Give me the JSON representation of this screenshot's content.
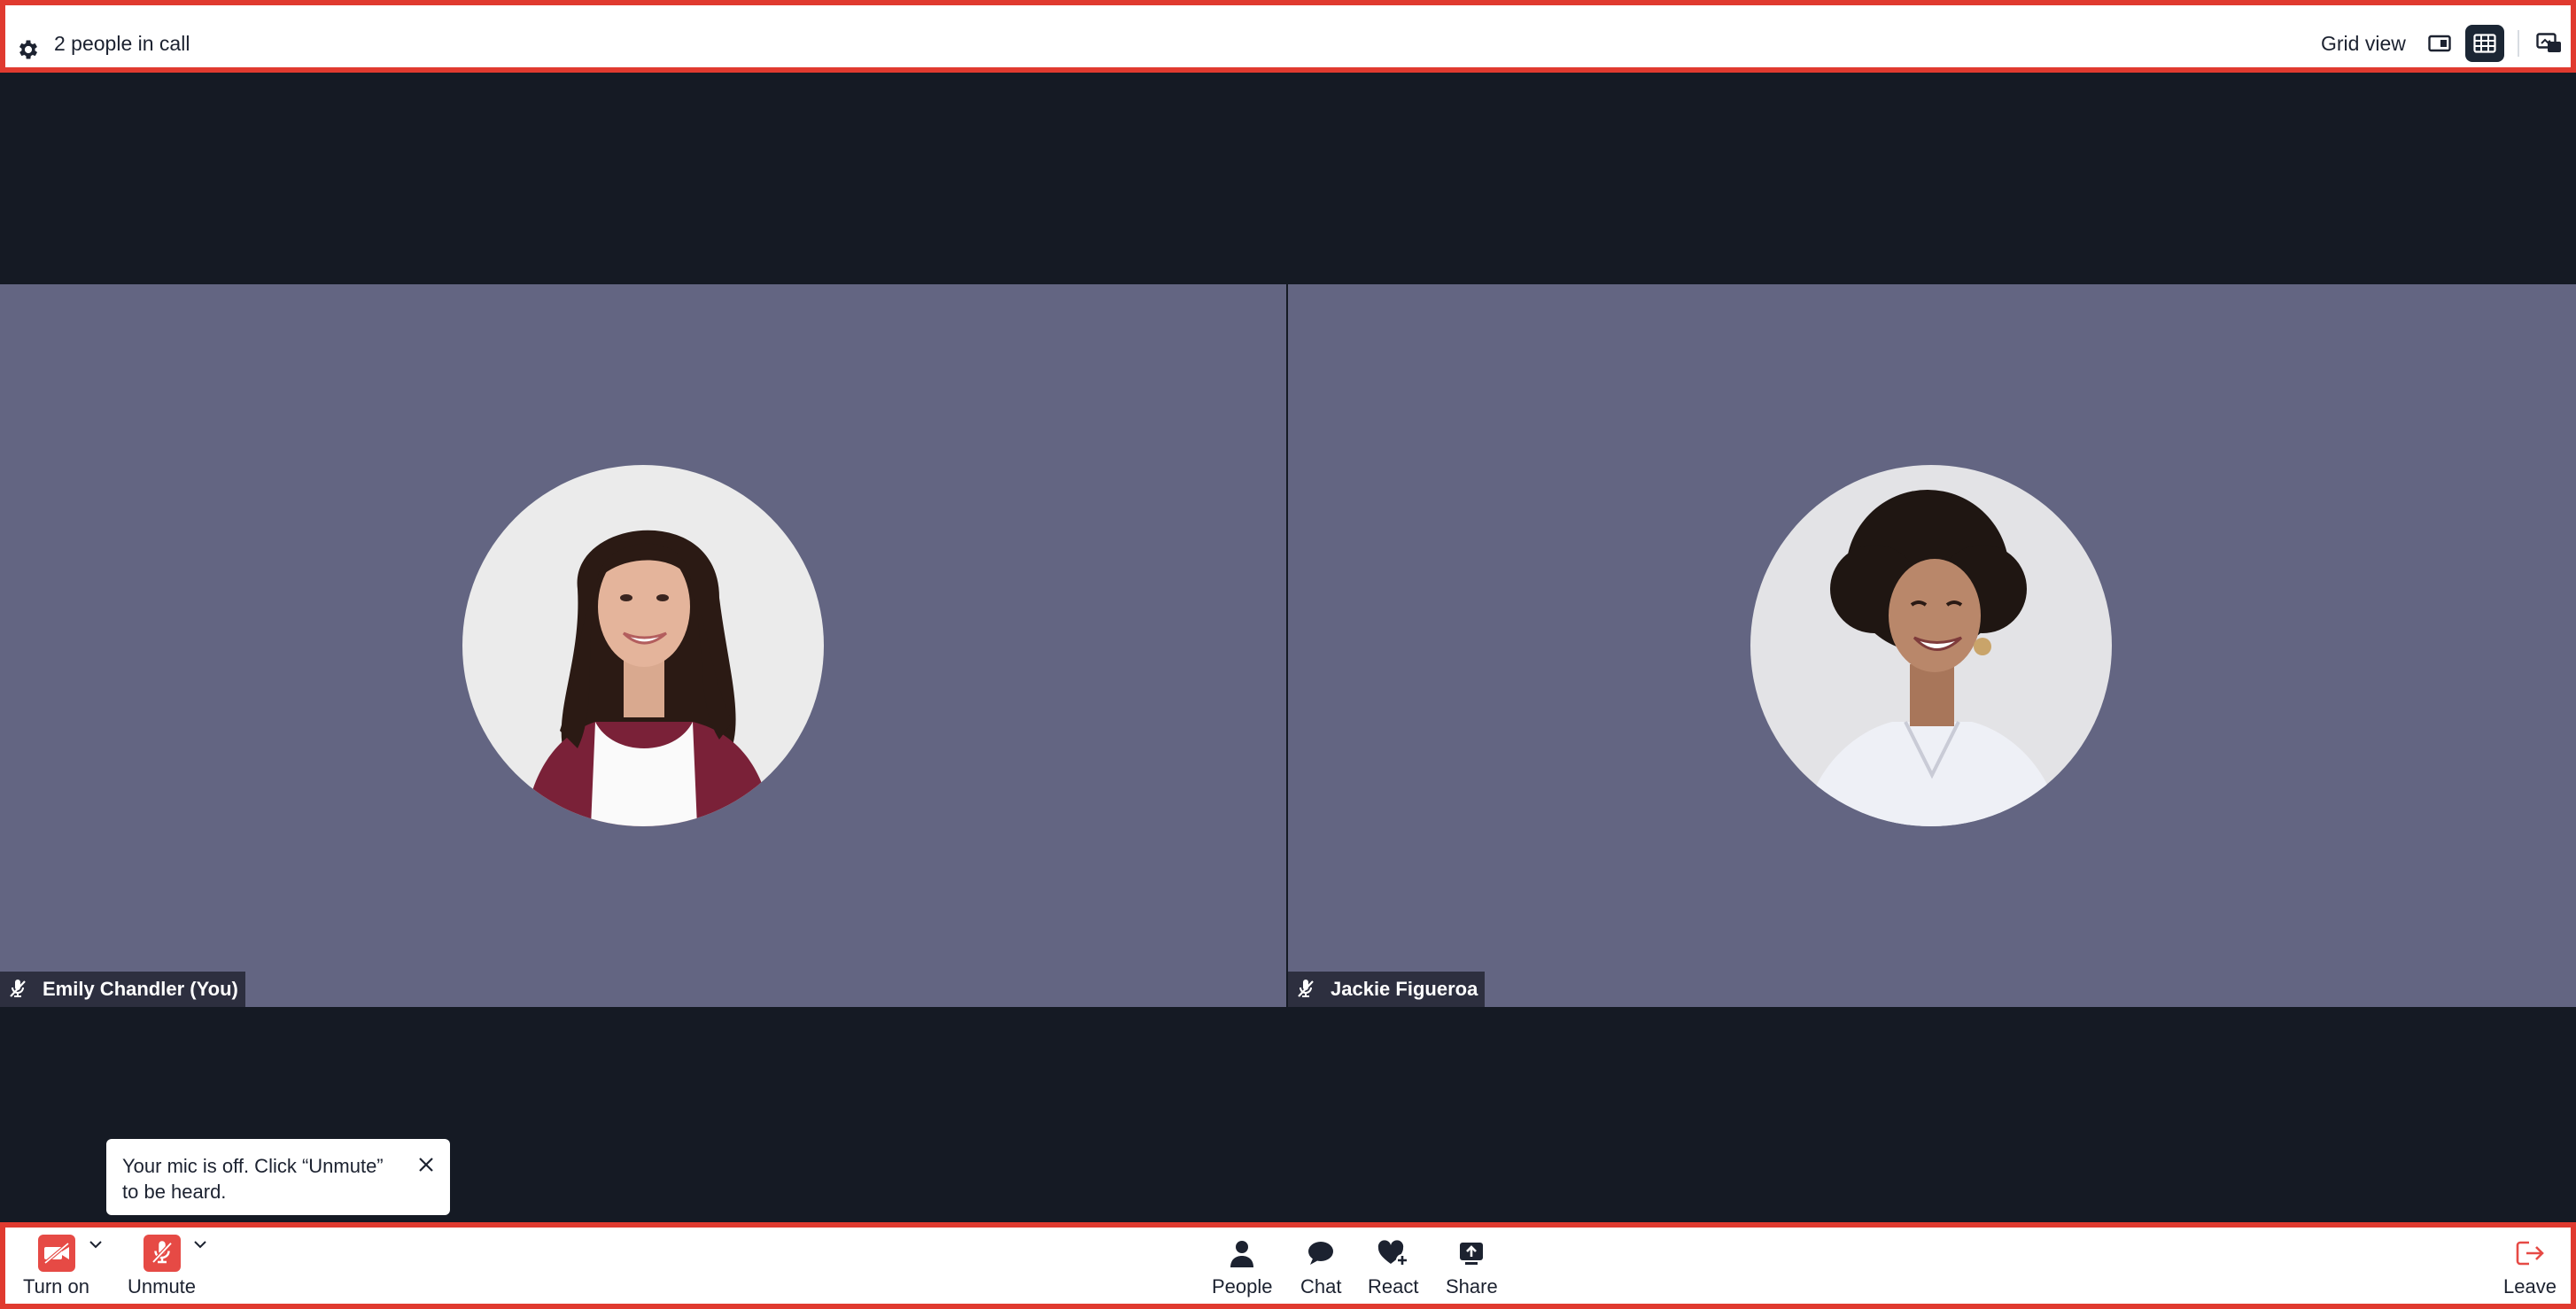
{
  "header": {
    "people_count": "2 people in call",
    "view_label": "Grid view"
  },
  "participants": [
    {
      "name": "Emily Chandler (You)",
      "mic": "muted"
    },
    {
      "name": "Jackie Figueroa",
      "mic": "muted"
    }
  ],
  "tooltip": {
    "line1": "Your mic is off. Click “Unmute”",
    "line2": "to be heard."
  },
  "controls": {
    "camera_label": "Turn on",
    "mic_label": "Unmute",
    "people_label": "People",
    "chat_label": "Chat",
    "react_label": "React",
    "share_label": "Share",
    "leave_label": "Leave"
  },
  "colors": {
    "accent_red": "#e64a45",
    "tile_bg": "#636582",
    "stage_bg": "#151a24",
    "frame_border": "#e03a2f"
  }
}
